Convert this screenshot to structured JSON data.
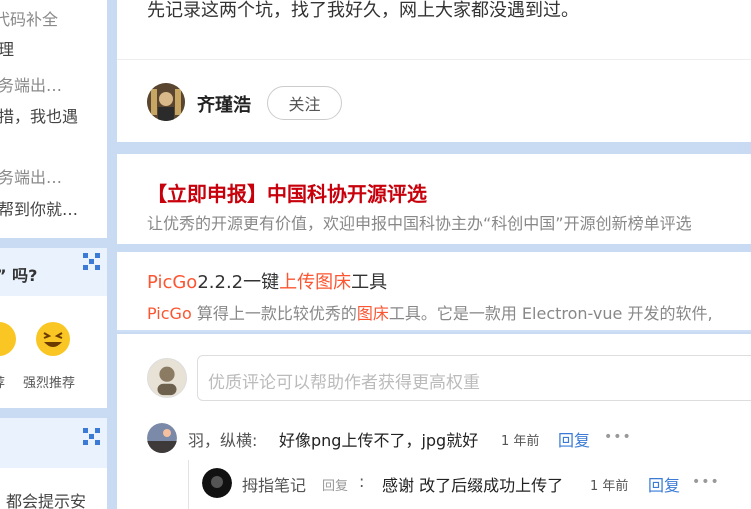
{
  "sidebar": {
    "card1": {
      "line1": "代码补全",
      "line2": "理",
      "line3": "务端出…",
      "line4": "措，我也遇",
      "line5": "务端出…",
      "line6": "帮到你就…"
    },
    "card2": {
      "header": "” 吗?",
      "option1_label": "荐",
      "option2_label": "强烈推荐"
    },
    "card3": {
      "line1": "都会提示安"
    }
  },
  "main": {
    "intro_text": "先记录这两个坑，找了我好久，网上大家都没遇到过。",
    "author": {
      "name": "齐瑾浩",
      "follow_label": "关注"
    },
    "recommend1": {
      "title": "【立即申报】中国科协开源评选",
      "desc": "让优秀的开源更有价值，欢迎申报中国科协主办“科创中国”开源创新榜单评选"
    },
    "recommend2": {
      "title_a": "PicGo",
      "title_b": "2.2.2一键",
      "title_c": "上传图床",
      "title_d": "工具",
      "desc_a": "PicGo",
      "desc_b": " 算得上一款比较优秀的",
      "desc_c": "图床",
      "desc_d": "工具。它是一款用 Electron-vue 开发的软件,"
    },
    "comment_box": {
      "placeholder": "优质评论可以帮助作者获得更高权重"
    },
    "comments": [
      {
        "name": "羽，纵横:",
        "text": "好像png上传不了，jpg就好",
        "time": "1 年前",
        "reply_label": "回复",
        "more": "•••"
      }
    ],
    "replies": [
      {
        "name": "拇指笔记",
        "reply_tag": "回复",
        "colon": ":",
        "text": "感谢 改了后缀成功上传了",
        "time": "1 年前",
        "reply_label": "回复",
        "more": "•••"
      }
    ]
  },
  "colors": {
    "background": "#c9daf3",
    "brand_red": "#c7000b",
    "highlight": "#fc5531",
    "link_blue": "#3b7bd6"
  },
  "icons": [
    "grid-icon",
    "smile-emoji-icon",
    "laugh-emoji-icon",
    "more-dots-icon"
  ]
}
